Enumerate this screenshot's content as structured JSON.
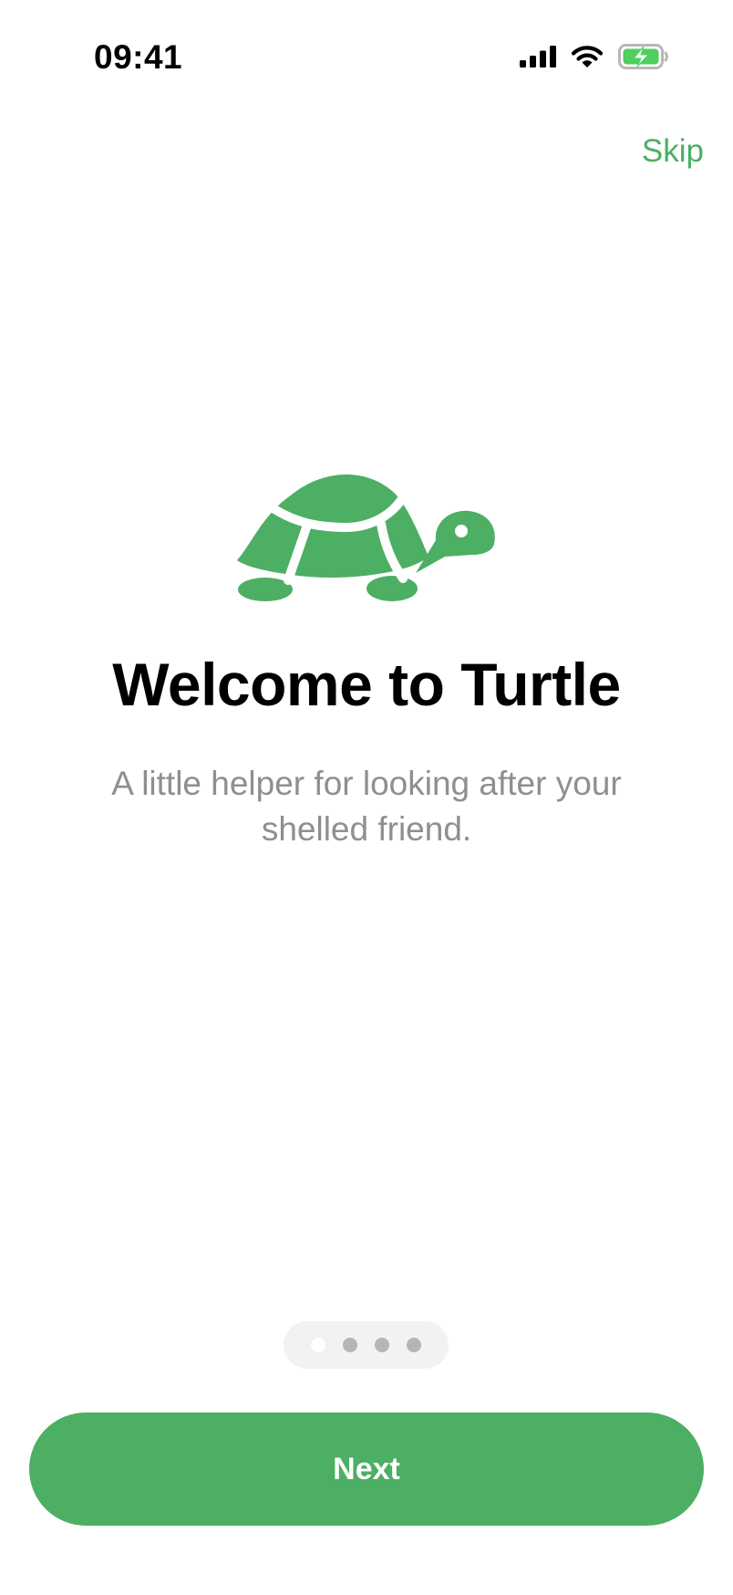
{
  "status_bar": {
    "time": "09:41",
    "icons": [
      "cellular-signal-icon",
      "wifi-icon",
      "battery-charging-icon"
    ]
  },
  "header": {
    "skip_label": "Skip"
  },
  "onboarding": {
    "illustration": "turtle-icon",
    "title": "Welcome to Turtle",
    "subtitle": "A little helper for looking after your shelled friend.",
    "page_count": 4,
    "current_page": 1
  },
  "footer": {
    "next_label": "Next"
  },
  "colors": {
    "accent": "#4caf63",
    "title_text": "#000000",
    "subtitle_text": "#8e8e93",
    "indicator_background": "#f2f2f2",
    "indicator_dot": "#b5b5b5",
    "indicator_dot_active": "#ffffff",
    "button_text": "#ffffff"
  }
}
